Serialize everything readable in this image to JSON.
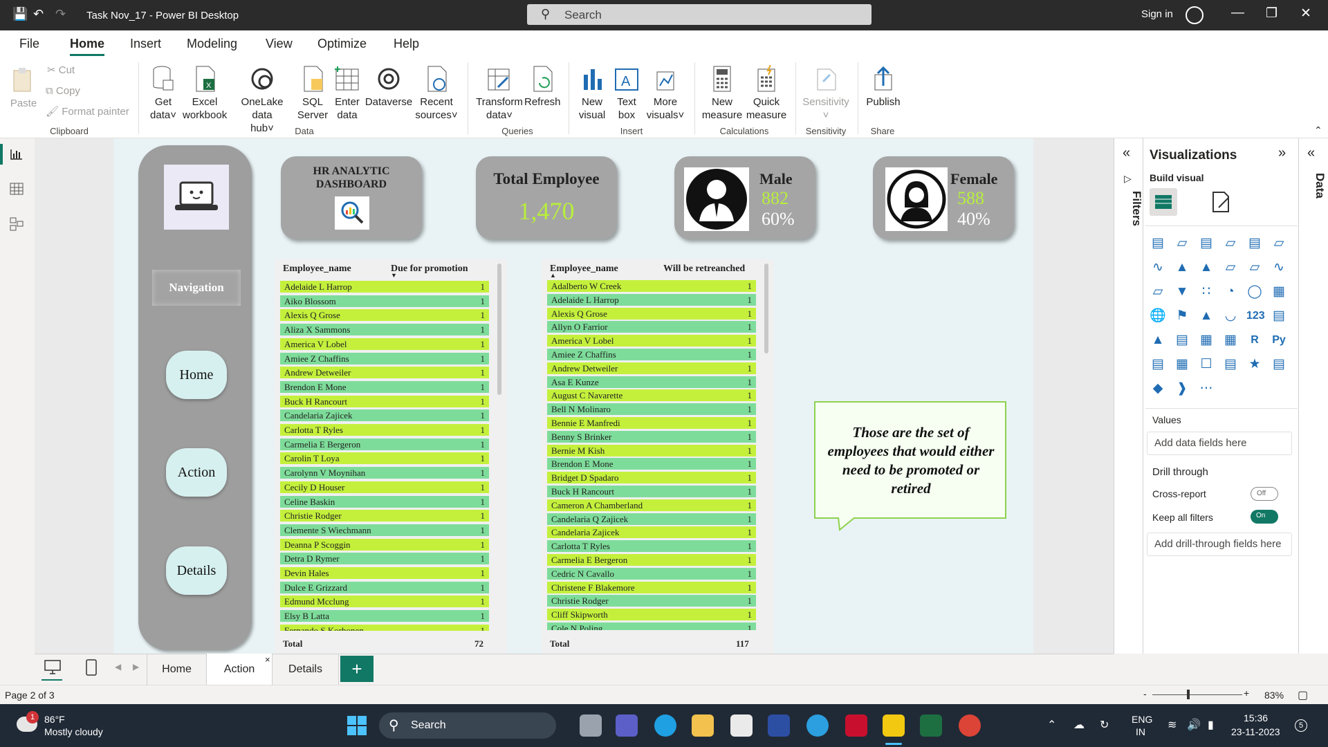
{
  "window": {
    "title": "Task Nov_17 - Power BI Desktop",
    "search_placeholder": "Search",
    "signin": "Sign in"
  },
  "menu": [
    "File",
    "Home",
    "Insert",
    "Modeling",
    "View",
    "Optimize",
    "Help"
  ],
  "ribbon": {
    "clipboard": {
      "paste": "Paste",
      "cut": "Cut",
      "copy": "Copy",
      "format_painter": "Format painter",
      "group": "Clipboard"
    },
    "data": {
      "get_data_1": "Get",
      "get_data_2": "data",
      "excel_1": "Excel",
      "excel_2": "workbook",
      "onelake_1": "OneLake data",
      "onelake_2": "hub",
      "sql_1": "SQL",
      "sql_2": "Server",
      "enter_1": "Enter",
      "enter_2": "data",
      "dataverse": "Dataverse",
      "recent_1": "Recent",
      "recent_2": "sources",
      "group": "Data"
    },
    "queries": {
      "transform_1": "Transform",
      "transform_2": "data",
      "refresh": "Refresh",
      "group": "Queries"
    },
    "insert": {
      "new_visual_1": "New",
      "new_visual_2": "visual",
      "text_box_1": "Text",
      "text_box_2": "box",
      "more_visuals_1": "More",
      "more_visuals_2": "visuals",
      "group": "Insert"
    },
    "calculations": {
      "new_measure_1": "New",
      "new_measure_2": "measure",
      "quick_measure_1": "Quick",
      "quick_measure_2": "measure",
      "group": "Calculations"
    },
    "sensitivity": {
      "label": "Sensitivity",
      "group": "Sensitivity"
    },
    "share": {
      "publish": "Publish",
      "group": "Share"
    }
  },
  "report": {
    "nav_label": "Navigation",
    "nav_buttons": [
      "Home",
      "Action",
      "Details"
    ],
    "title_card_1": "HR ANALYTIC",
    "title_card_2": "DASHBOARD",
    "total_employee": {
      "label": "Total Employee",
      "value": "1,470"
    },
    "male": {
      "label": "Male",
      "value": "882",
      "pct": "60%"
    },
    "female": {
      "label": "Female",
      "value": "588",
      "pct": "40%"
    },
    "callout": "Those are the set of employees that would either need to be promoted or retired",
    "promotion_table": {
      "col1": "Employee_name",
      "col2": "Due for promotion",
      "total_label": "Total",
      "total": "72",
      "rows": [
        "Adelaide L Harrop",
        "Aiko Blossom",
        "Alexis Q Grose",
        "Aliza X Sammons",
        "America V Lobel",
        "Amiee Z Chaffins",
        "Andrew Detweiler",
        "Brendon E Mone",
        "Buck H Rancourt",
        "Candelaria Zajicek",
        "Carlotta T Ryles",
        "Carmelia E Bergeron",
        "Carolin T Loya",
        "Carolynn V Moynihan",
        "Cecily D Houser",
        "Celine Baskin",
        "Christie Rodger",
        "Clemente S Wiechmann",
        "Deanna P Scoggin",
        "Detra D Rymer",
        "Devin Hales",
        "Dulce E Grizzard",
        "Edmund Mcclung",
        "Elsy B Latta",
        "Fernando S Korhonen"
      ],
      "value": "1"
    },
    "retrench_table": {
      "col1": "Employee_name",
      "col2": "Will be retreanched",
      "total_label": "Total",
      "total": "117",
      "rows": [
        "Adalberto W Creek",
        "Adelaide L Harrop",
        "Alexis Q Grose",
        "Allyn O Farrior",
        "America V Lobel",
        "Amiee Z Chaffins",
        "Andrew Detweiler",
        "Asa E Kunze",
        "August C Navarette",
        "Bell N Molinaro",
        "Bennie E Manfredi",
        "Benny S Brinker",
        "Bernie M Kish",
        "Brendon E Mone",
        "Bridget D Spadaro",
        "Buck H Rancourt",
        "Cameron A Chamberland",
        "Candelaria Q Zajicek",
        "Candelaria Zajicek",
        "Carlotta T Ryles",
        "Carmelia E Bergeron",
        "Cedric N Cavallo",
        "Christene F Blakemore",
        "Christie Rodger",
        "Cliff Skipworth",
        "Cole N Poling"
      ],
      "value": "1"
    }
  },
  "panes": {
    "filters": "Filters",
    "visualizations": "Visualizations",
    "build_visual": "Build visual",
    "values": "Values",
    "add_data_fields": "Add data fields here",
    "drill_through": "Drill through",
    "cross_report": "Cross-report",
    "cross_report_state": "Off",
    "keep_all_filters": "Keep all filters",
    "keep_all_filters_state": "On",
    "add_drill_fields": "Add drill-through fields here",
    "data": "Data"
  },
  "page_tabs": [
    "Home",
    "Action",
    "Details"
  ],
  "status": {
    "page": "Page 2 of 3",
    "zoom": "83%"
  },
  "taskbar": {
    "weather_temp": "86°F",
    "weather_desc": "Mostly cloudy",
    "weather_badge": "1",
    "search": "Search",
    "lang_1": "ENG",
    "lang_2": "IN",
    "time": "15:36",
    "date": "23-11-2023",
    "notif": "5"
  },
  "colors": {
    "accent": "#117865",
    "row_green": "#c4f03c",
    "row_teal": "#7edc9a",
    "value_green": "#b8ef3b"
  }
}
